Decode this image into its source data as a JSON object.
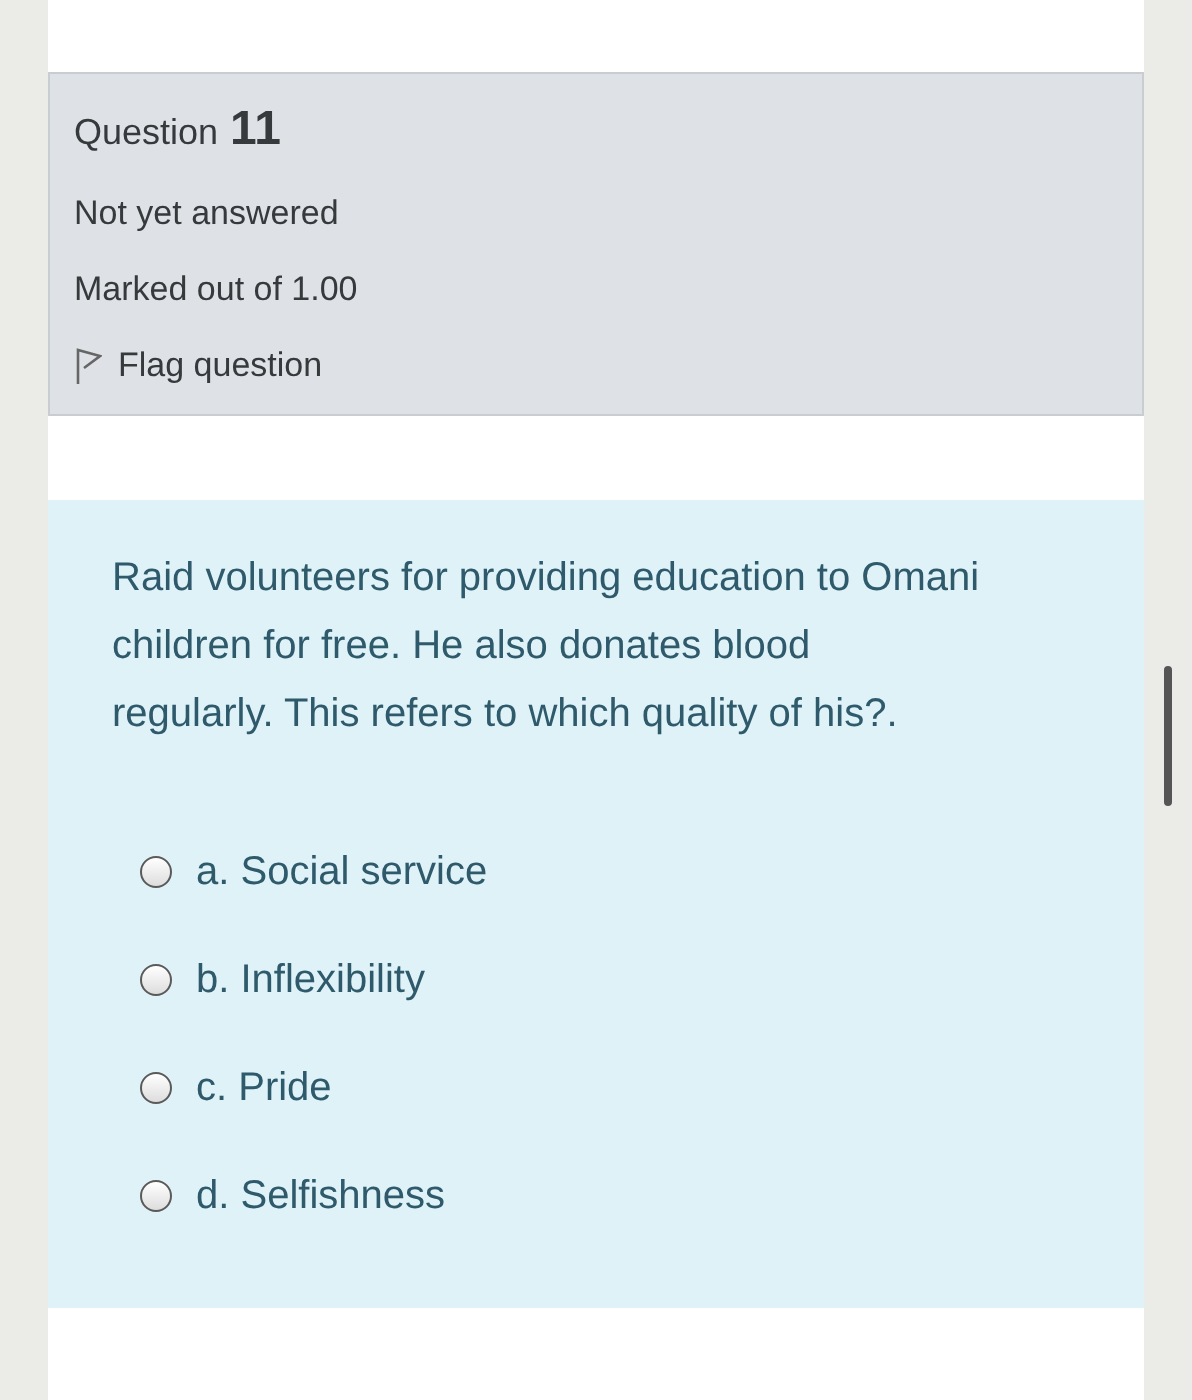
{
  "info": {
    "label": "Question",
    "number": "11",
    "status": "Not yet answered",
    "marks": "Marked out of 1.00",
    "flag": {
      "label": "Flag question",
      "flagged": false
    }
  },
  "question": {
    "text": "Raid volunteers for providing education to Omani children for free. He also donates blood regularly. This refers to which quality of his?.",
    "options": [
      {
        "label": "a. Social service",
        "selected": false
      },
      {
        "label": "b. Inflexibility",
        "selected": false
      },
      {
        "label": "c. Pride",
        "selected": false
      },
      {
        "label": "d. Selfishness",
        "selected": false
      }
    ]
  }
}
